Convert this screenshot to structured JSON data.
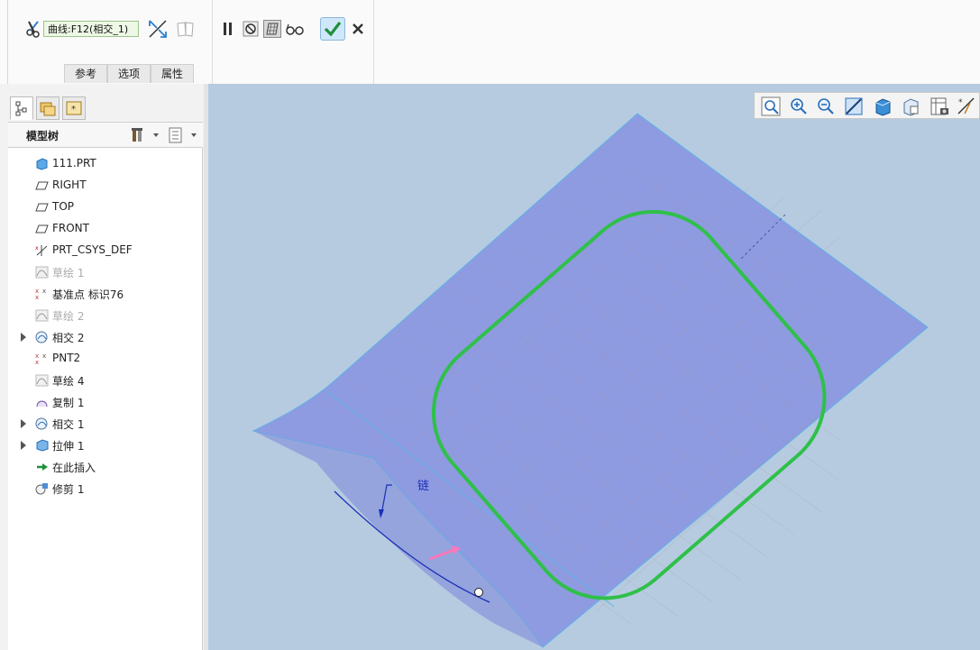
{
  "dashboard": {
    "curve_field_value": "曲线:F12(相交_1)",
    "tabs": [
      "参考",
      "选项",
      "属性"
    ]
  },
  "model_tree": {
    "title": "模型树",
    "items": [
      {
        "label": "111.PRT",
        "icon": "part-icon",
        "expandable": false,
        "dim": false
      },
      {
        "label": "RIGHT",
        "icon": "datum-plane-icon",
        "expandable": false,
        "dim": false
      },
      {
        "label": "TOP",
        "icon": "datum-plane-icon",
        "expandable": false,
        "dim": false
      },
      {
        "label": "FRONT",
        "icon": "datum-plane-icon",
        "expandable": false,
        "dim": false
      },
      {
        "label": "PRT_CSYS_DEF",
        "icon": "csys-icon",
        "expandable": false,
        "dim": false
      },
      {
        "label": "草绘 1",
        "icon": "sketch-icon",
        "expandable": false,
        "dim": true
      },
      {
        "label": "基准点 标识76",
        "icon": "datum-point-icon",
        "expandable": false,
        "dim": false
      },
      {
        "label": "草绘 2",
        "icon": "sketch-icon",
        "expandable": false,
        "dim": true
      },
      {
        "label": "相交 2",
        "icon": "intersect-icon",
        "expandable": true,
        "dim": false
      },
      {
        "label": "PNT2",
        "icon": "datum-point-icon",
        "expandable": false,
        "dim": false
      },
      {
        "label": "草绘 4",
        "icon": "sketch-icon",
        "expandable": false,
        "dim": false
      },
      {
        "label": "复制 1",
        "icon": "copy-icon",
        "expandable": false,
        "dim": false
      },
      {
        "label": "相交 1",
        "icon": "intersect-icon",
        "expandable": true,
        "dim": false
      },
      {
        "label": "拉伸 1",
        "icon": "extrude-icon",
        "expandable": true,
        "dim": false
      },
      {
        "label": "在此插入",
        "icon": "insert-here-icon",
        "expandable": false,
        "dim": false
      },
      {
        "label": "修剪 1",
        "icon": "trim-feature-icon",
        "expandable": false,
        "dim": false
      }
    ]
  },
  "viewport": {
    "chain_label": "链"
  },
  "colors": {
    "surface": "#8e9be0",
    "trim_curve": "#2fc04a",
    "background": "#b6cbe0",
    "arrow": "#ff77bb",
    "chain": "#1b2fb8"
  }
}
